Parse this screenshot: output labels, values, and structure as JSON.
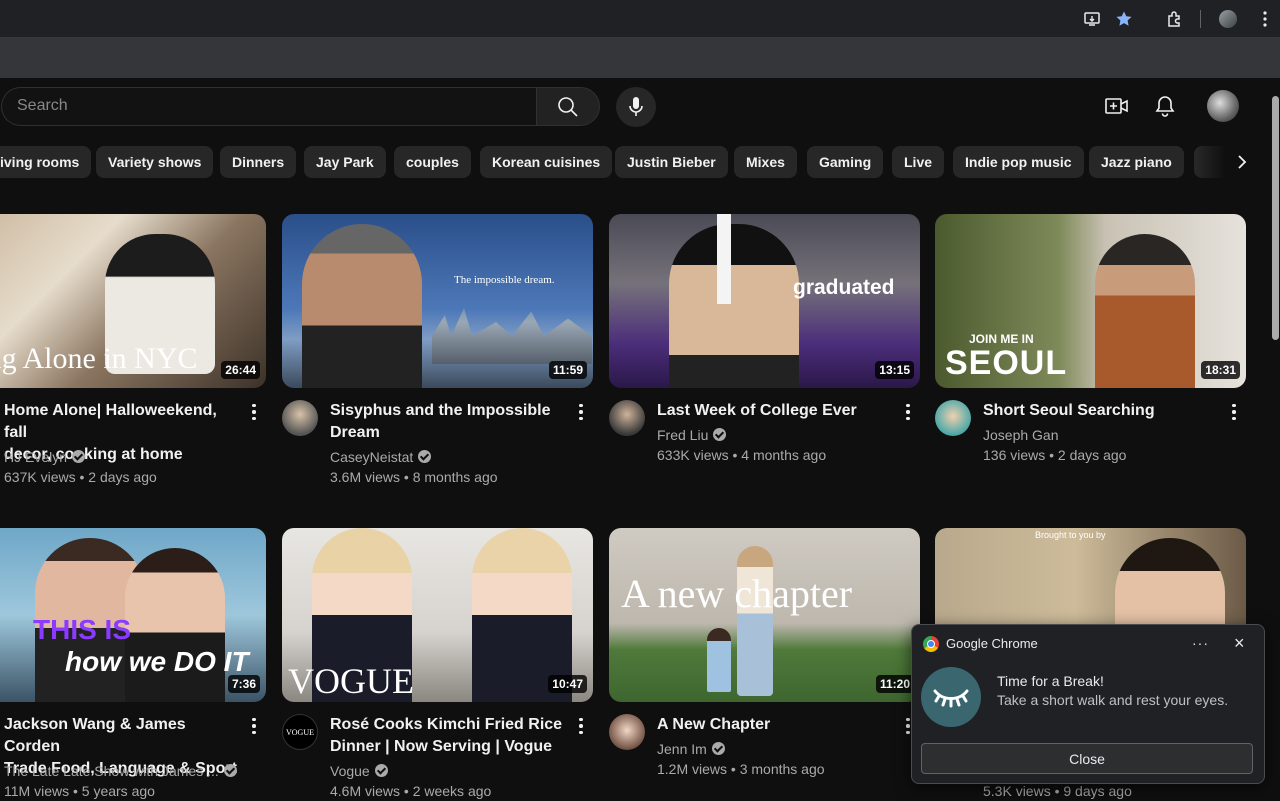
{
  "browser": {
    "icons": [
      "install-app-icon",
      "bookmark-star-icon",
      "extensions-icon",
      "profile-icon",
      "menu-icon"
    ]
  },
  "search": {
    "placeholder": "Search"
  },
  "chips": [
    "iving rooms",
    "Variety shows",
    "Dinners",
    "Jay Park",
    "couples",
    "Korean cuisines",
    "Justin Bieber",
    "Mixes",
    "Gaming",
    "Live",
    "Indie pop music",
    "Jazz piano"
  ],
  "videos": [
    {
      "title_l1": "Home Alone| Halloweekend, fall",
      "title_l2": "decor, cooking at home",
      "channel": "HJ Evelyn",
      "stats": "637K views • 2 days ago",
      "duration": "26:44",
      "overlay": "iving Alone in NYC"
    },
    {
      "title_l1": "Sisyphus and the Impossible",
      "title_l2": "Dream",
      "channel": "CaseyNeistat",
      "stats": "3.6M views • 8 months ago",
      "duration": "11:59",
      "overlay": "The impossible dream."
    },
    {
      "title_l1": "Last Week of College Ever",
      "title_l2": "",
      "channel": "Fred Liu",
      "stats": "633K views • 4 months ago",
      "duration": "13:15",
      "overlay": "graduated"
    },
    {
      "title_l1": "Short Seoul Searching",
      "title_l2": "",
      "channel": "Joseph Gan",
      "stats": "136 views • 2 days ago",
      "duration": "18:31",
      "overlay_small": "JOIN ME IN",
      "overlay": "SEOUL"
    },
    {
      "title_l1": "Jackson Wang & James Corden",
      "title_l2": "Trade Food, Language & Sport",
      "channel": "The Late Late Show with James ...",
      "stats": "11M views • 5 years ago",
      "duration": "7:36",
      "overlay_small": "THIS IS",
      "overlay": "how we DO IT"
    },
    {
      "title_l1": "Rosé Cooks Kimchi Fried Rice",
      "title_l2": "Dinner | Now Serving | Vogue",
      "channel": "Vogue",
      "stats": "4.6M views • 2 weeks ago",
      "duration": "10:47",
      "overlay": "VOGUE"
    },
    {
      "title_l1": "A New Chapter",
      "title_l2": "",
      "channel": "Jenn Im",
      "stats": "1.2M views • 3 months ago",
      "duration": "11:20",
      "overlay": "A new chapter"
    },
    {
      "stats": "5.3K views • 9 days ago",
      "overlay": "Brought to you by"
    }
  ],
  "notification": {
    "app": "Google Chrome",
    "title": "Time for a Break!",
    "message": "Take a short walk and rest your eyes.",
    "button": "Close"
  }
}
